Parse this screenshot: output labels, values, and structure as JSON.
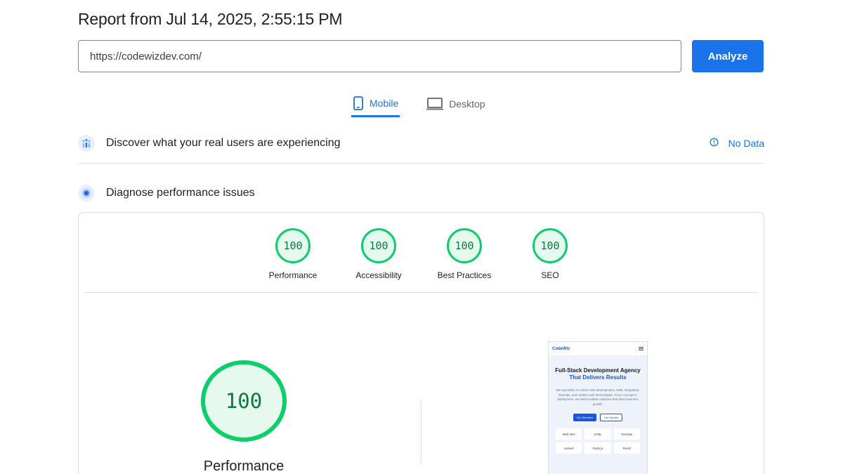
{
  "report": {
    "title": "Report from Jul 14, 2025, 2:55:15 PM"
  },
  "search": {
    "value": "https://codewizdev.com/",
    "analyze_label": "Analyze"
  },
  "tabs": [
    {
      "label": "Mobile",
      "icon": "phone-icon",
      "active": true
    },
    {
      "label": "Desktop",
      "icon": "monitor-icon",
      "active": false
    }
  ],
  "real_users": {
    "label": "Discover what your real users are experiencing",
    "status": "No Data"
  },
  "diagnose": {
    "label": "Diagnose performance issues"
  },
  "scores": [
    {
      "name": "Performance",
      "value": "100"
    },
    {
      "name": "Accessibility",
      "value": "100"
    },
    {
      "name": "Best Practices",
      "value": "100"
    },
    {
      "name": "SEO",
      "value": "100"
    }
  ],
  "main_score": {
    "value": "100",
    "name": "Performance"
  },
  "preview": {
    "brand": "CodeWiz",
    "headline_part1": "Full-Stack Development Agency ",
    "headline_accent": "That Delivers Results",
    "paragraph": "We specialize in custom web development, AI/ML integration, DevOps, and modern web technologies. From concept to deployment, we build scalable solutions that drive business growth.",
    "primary_button": "Our Services",
    "secondary_button": "Get Started",
    "chips": [
      "Web Dev",
      "AI/ML",
      "DevOps",
      "Laravel",
      "Node.js",
      "React"
    ]
  },
  "colors": {
    "accent": "#1a73e8",
    "pass": "#0cce6b",
    "pass_bg": "#e6f9ee",
    "pass_text": "#0a7a3f"
  }
}
